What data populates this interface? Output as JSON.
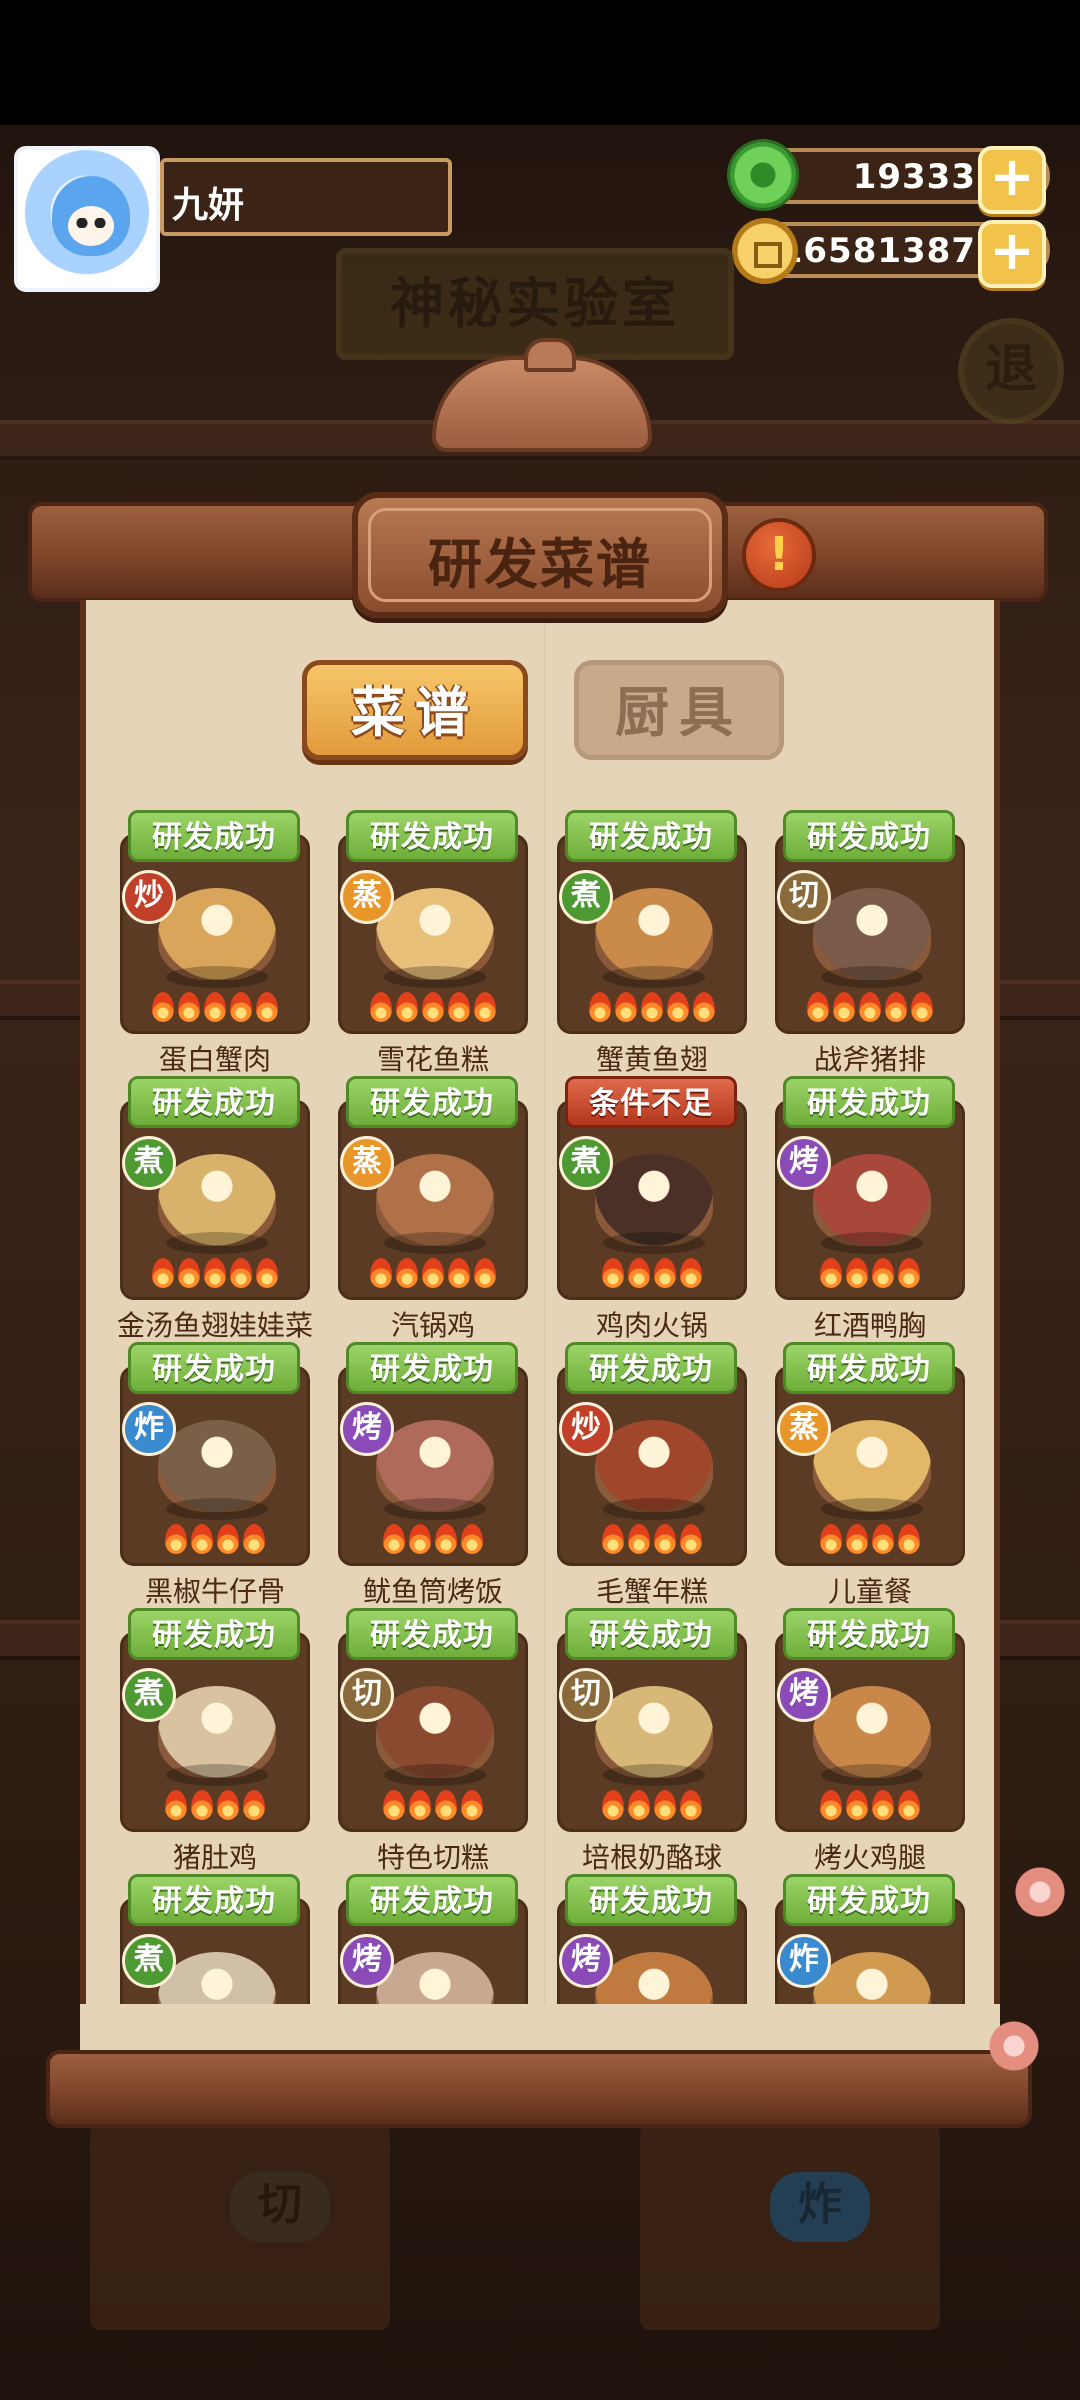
{
  "player": {
    "name": "九妍"
  },
  "currency": {
    "jade": "19333",
    "coins": "16581387"
  },
  "background": {
    "lab_sign": "神秘实验室",
    "back_label": "退",
    "counter_left": "切",
    "counter_right": "炸"
  },
  "panel": {
    "title": "研发菜谱",
    "tabs": [
      {
        "label": "菜谱",
        "active": true
      },
      {
        "label": "厨具",
        "active": false
      }
    ]
  },
  "recipes": [
    {
      "status": "研发成功",
      "method": "炒",
      "name": "蛋白蟹肉",
      "flames": 5
    },
    {
      "status": "研发成功",
      "method": "蒸",
      "name": "雪花鱼糕",
      "flames": 5
    },
    {
      "status": "研发成功",
      "method": "煮",
      "name": "蟹黄鱼翅",
      "flames": 5
    },
    {
      "status": "研发成功",
      "method": "切",
      "name": "战斧猪排",
      "flames": 5
    },
    {
      "status": "研发成功",
      "method": "煮",
      "name": "金汤鱼翅娃娃菜",
      "flames": 5
    },
    {
      "status": "研发成功",
      "method": "蒸",
      "name": "汽锅鸡",
      "flames": 5
    },
    {
      "status": "条件不足",
      "method": "煮",
      "name": "鸡肉火锅",
      "flames": 4
    },
    {
      "status": "研发成功",
      "method": "烤",
      "name": "红酒鸭胸",
      "flames": 4
    },
    {
      "status": "研发成功",
      "method": "炸",
      "name": "黑椒牛仔骨",
      "flames": 4
    },
    {
      "status": "研发成功",
      "method": "烤",
      "name": "鱿鱼筒烤饭",
      "flames": 4
    },
    {
      "status": "研发成功",
      "method": "炒",
      "name": "毛蟹年糕",
      "flames": 4
    },
    {
      "status": "研发成功",
      "method": "蒸",
      "name": "儿童餐",
      "flames": 4
    },
    {
      "status": "研发成功",
      "method": "煮",
      "name": "猪肚鸡",
      "flames": 4
    },
    {
      "status": "研发成功",
      "method": "切",
      "name": "特色切糕",
      "flames": 4
    },
    {
      "status": "研发成功",
      "method": "切",
      "name": "培根奶酪球",
      "flames": 4
    },
    {
      "status": "研发成功",
      "method": "烤",
      "name": "烤火鸡腿",
      "flames": 4
    },
    {
      "status": "研发成功",
      "method": "煮",
      "name": "",
      "flames": 0
    },
    {
      "status": "研发成功",
      "method": "烤",
      "name": "",
      "flames": 0
    },
    {
      "status": "研发成功",
      "method": "烤",
      "name": "",
      "flames": 0
    },
    {
      "status": "研发成功",
      "method": "炸",
      "name": "",
      "flames": 0
    }
  ],
  "method_colors": {
    "炒": "#c0402a",
    "蒸": "#e8962a",
    "煮": "#4e9a32",
    "切": "#8a6a3a",
    "烤": "#8a4ab8",
    "炸": "#3a8ad0"
  },
  "icons": {
    "jade": "jade-coin-icon",
    "coin": "gold-coin-icon",
    "plus": "plus-icon",
    "warning": "exclamation-icon",
    "flame": "flame-icon"
  }
}
